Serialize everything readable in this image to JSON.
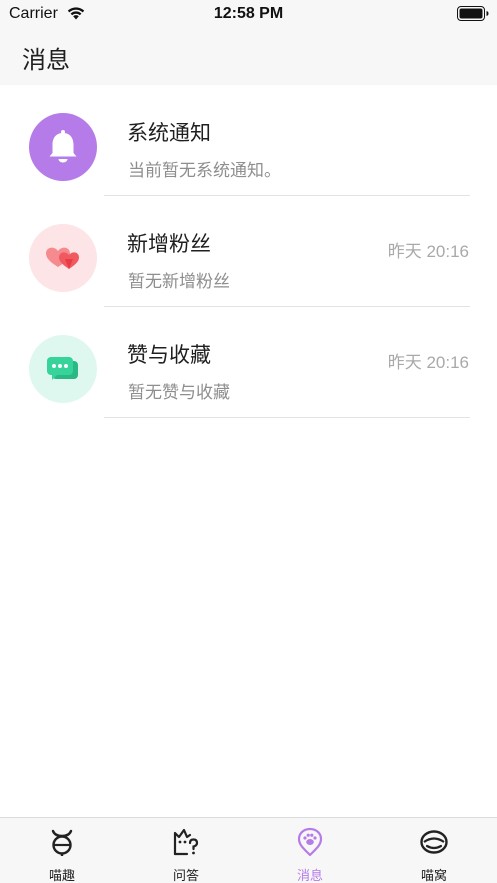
{
  "status_bar": {
    "carrier": "Carrier",
    "time": "12:58 PM"
  },
  "nav": {
    "title": "消息"
  },
  "messages": [
    {
      "title": "系统通知",
      "subtitle": "当前暂无系统通知。",
      "time": "",
      "icon": "bell-icon",
      "avatar_bg": "#b57be8",
      "icon_color": "#ffffff"
    },
    {
      "title": "新增粉丝",
      "subtitle": "暂无新增粉丝",
      "time": "昨天 20:16",
      "icon": "hearts-icon",
      "avatar_bg": "#fde4e6",
      "icon_color": "#f0595f"
    },
    {
      "title": "赞与收藏",
      "subtitle": "暂无赞与收藏",
      "time": "昨天 20:16",
      "icon": "chat-bubbles-icon",
      "avatar_bg": "#dff8ef",
      "icon_color": "#36d39a"
    }
  ],
  "tab_bar": {
    "active_color": "#b57be8",
    "tabs": [
      {
        "label": "喵趣",
        "icon": "cat-face-icon",
        "active": false
      },
      {
        "label": "问答",
        "icon": "cat-question-icon",
        "active": false
      },
      {
        "label": "消息",
        "icon": "paw-pin-icon",
        "active": true
      },
      {
        "label": "喵窝",
        "icon": "cat-bed-icon",
        "active": false
      }
    ]
  }
}
